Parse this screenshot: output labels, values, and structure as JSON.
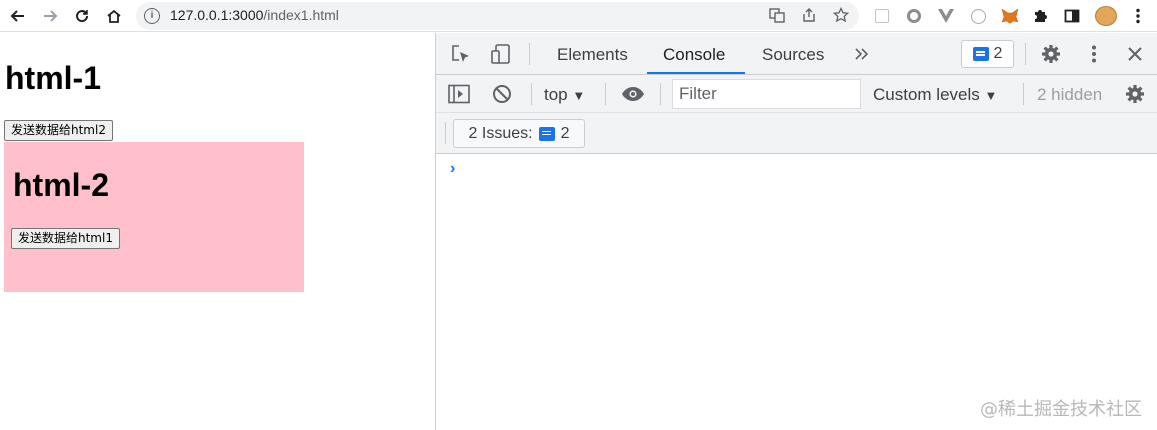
{
  "browser": {
    "url_host": "127.0.0.1:3000",
    "url_path": "/index1.html"
  },
  "page": {
    "heading": "html-1",
    "send_button_label": "发送数据给html2",
    "iframe": {
      "heading": "html-2",
      "send_button_label": "发送数据给html1",
      "background": "#ffc0cb"
    }
  },
  "devtools": {
    "tabs": [
      "Elements",
      "Console",
      "Sources"
    ],
    "active_tab": "Console",
    "message_badge_count": "2",
    "context": "top",
    "filter_placeholder": "Filter",
    "levels_label": "Custom levels",
    "hidden_label": "2 hidden",
    "issues_label": "2 Issues:",
    "issues_count": "2",
    "prompt": "›"
  },
  "watermark": "@稀土掘金技术社区",
  "colors": {
    "accent": "#1a73e8",
    "devtools_bg": "#f1f3f4"
  }
}
